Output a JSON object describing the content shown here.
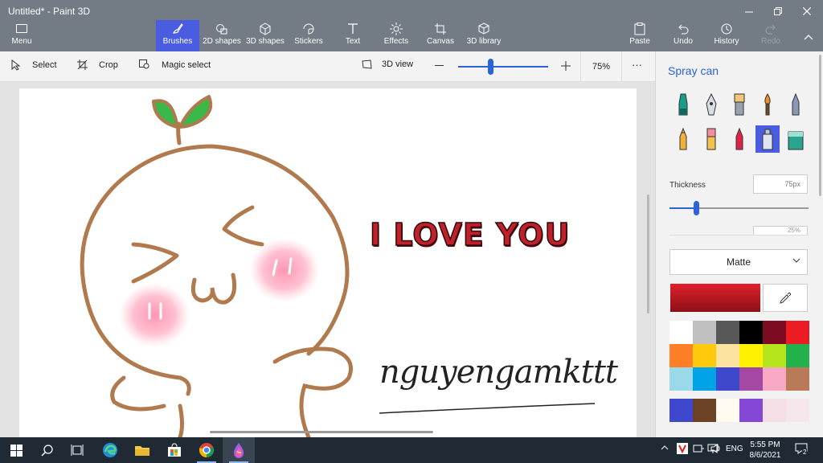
{
  "window": {
    "title": "Untitled* - Paint 3D"
  },
  "ribbon": {
    "menu": "Menu",
    "tools": [
      {
        "label": "Brushes",
        "icon": "brush-icon"
      },
      {
        "label": "2D shapes",
        "icon": "2d-shapes-icon"
      },
      {
        "label": "3D shapes",
        "icon": "3d-shapes-icon"
      },
      {
        "label": "Stickers",
        "icon": "stickers-icon"
      },
      {
        "label": "Text",
        "icon": "text-icon"
      },
      {
        "label": "Effects",
        "icon": "effects-icon"
      },
      {
        "label": "Canvas",
        "icon": "canvas-icon"
      },
      {
        "label": "3D library",
        "icon": "3d-library-icon"
      }
    ],
    "paste": "Paste",
    "undo": "Undo",
    "history": "History",
    "redo": "Redo"
  },
  "toolbar": {
    "select": "Select",
    "crop": "Crop",
    "magic_select": "Magic select",
    "view3d": "3D view",
    "zoom": "75%",
    "more": "···",
    "zoom_slider_fraction": 0.33
  },
  "canvas": {
    "text_love": "I LOVE YOU",
    "signature": "nguyengamkttt"
  },
  "panel": {
    "title": "Spray can",
    "thickness_label": "Thickness",
    "thickness_value": "75px",
    "thickness_fraction": 0.19,
    "opacity_value_partial": "25%",
    "finish": "Matte",
    "current_color": "#c8212a",
    "colors": [
      "#ffffff",
      "#c0c0c0",
      "#585858",
      "#000000",
      "#7d0c22",
      "#ed1c24",
      "#ff7f27",
      "#ffc90e",
      "#fde3a0",
      "#fff200",
      "#b5e61d",
      "#22b14c",
      "#99d9ea",
      "#00a2e8",
      "#3f48cc",
      "#a349a4",
      "#f7a8c4",
      "#b97a57"
    ],
    "custom_colors": [
      "#3f48cc",
      "#6b4226",
      "#fffbf0",
      "#8548d6",
      "#f4dfe6",
      "#f4e6ea"
    ]
  },
  "taskbar": {
    "lang": "ENG",
    "time": "5:55 PM",
    "date": "8/6/2021",
    "notifications": "2"
  }
}
